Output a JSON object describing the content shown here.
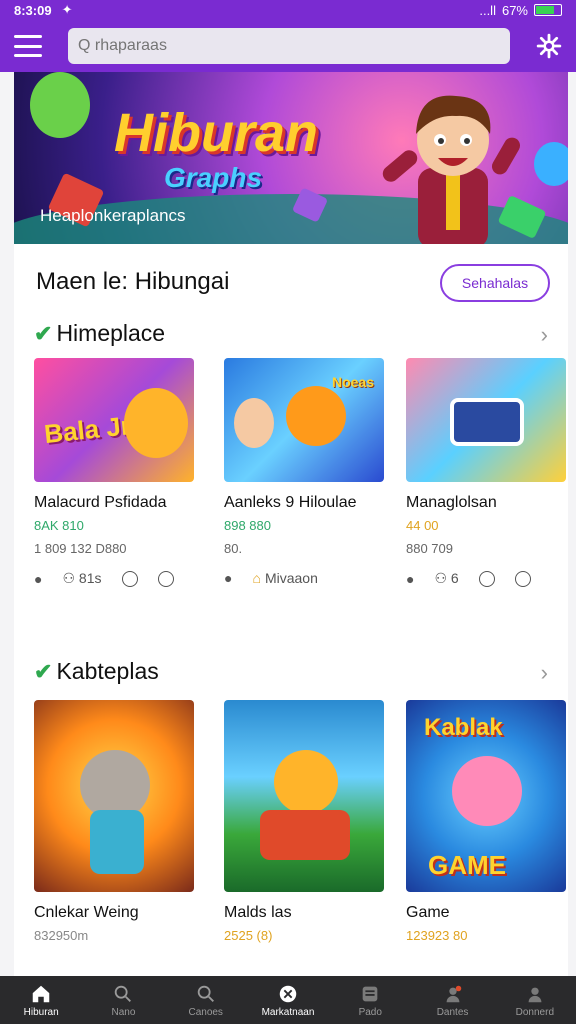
{
  "status": {
    "time": "8:3:09",
    "battery": "67%",
    "signal": "...ll"
  },
  "search": {
    "placeholder": "Q rhaparaas"
  },
  "banner": {
    "title": "Hiburan",
    "subtitle": "Graphs",
    "caption": "Heaplonkeraplancs"
  },
  "main": {
    "title": "Maen le: Hibungai",
    "see_all_label": "Sehahalas"
  },
  "categories": [
    {
      "title": "Himeplace",
      "items": [
        {
          "name": "Malacurd Psfidada",
          "price": "8AK 810",
          "price_color": "#2fa86a",
          "meta": "1 809 132  D880",
          "icon_text": [
            "",
            "81s",
            "",
            ""
          ]
        },
        {
          "name": "Aanleks 9 Hiloulae",
          "price": "898 880",
          "price_color": "#2fa86a",
          "meta": "80.",
          "icon_text": [
            "",
            "Mivaaon"
          ]
        },
        {
          "name": "Managlolsan",
          "price": "44 00",
          "price_color": "#e0a320",
          "meta": "880 709",
          "icon_text": [
            "",
            "6",
            "",
            ""
          ]
        }
      ]
    },
    {
      "title": "Kabteplas",
      "items": [
        {
          "name": "Cnlekar Weing",
          "price": "832950m",
          "price_color": "#888888"
        },
        {
          "name": "Malds las",
          "price": "2525 (8)",
          "price_color": "#e0a320"
        },
        {
          "name": "Game",
          "price": "123923 80",
          "price_color": "#e0a320"
        }
      ]
    }
  ],
  "thumb_texts": [
    "Bala Jnuas",
    "Noeas",
    "",
    "",
    "",
    "Kablak",
    "GAME"
  ],
  "nav": [
    {
      "label": "Hiburan",
      "icon": "home-icon",
      "active": true
    },
    {
      "label": "Nano",
      "icon": "search-icon",
      "active": false
    },
    {
      "label": "Canoes",
      "icon": "search-icon",
      "active": false
    },
    {
      "label": "Markatnaan",
      "icon": "store-icon",
      "active": true
    },
    {
      "label": "Pado",
      "icon": "inbox-icon",
      "active": false
    },
    {
      "label": "Dantes",
      "icon": "notify-icon",
      "active": false
    },
    {
      "label": "Donnerd",
      "icon": "account-icon",
      "active": false
    }
  ]
}
